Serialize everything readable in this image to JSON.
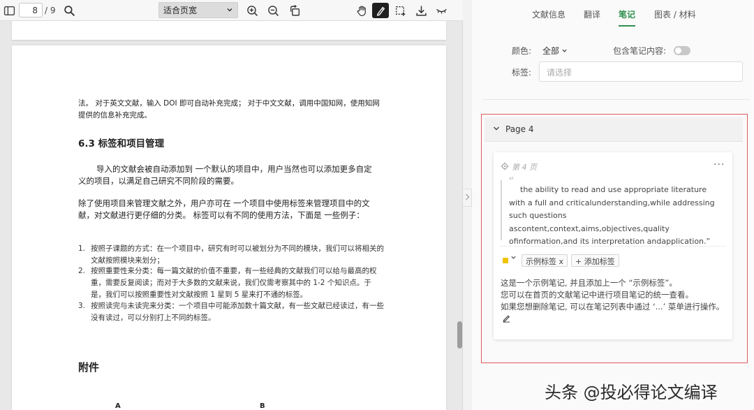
{
  "toolbar": {
    "current_page": "8",
    "total_pages": "/ 9",
    "zoom_select": "适合页宽",
    "icons": [
      "sidebar-toggle-icon",
      "search-icon",
      "zoom-in-icon",
      "zoom-out-icon",
      "rotate-icon",
      "hand-icon",
      "highlight-pen-icon",
      "select-area-icon",
      "download-icon",
      "eye-closed-icon"
    ]
  },
  "pdf": {
    "para1": "法。 对于英文文献，输入 DOI 即可自动补充完成； 对于中文文献，调用中国知网，使用知网提供的信息补充完成。",
    "heading": "6.3  标签和项目管理",
    "para2": "导入的文献会被自动添加到 一个默认的项目中，用户当然也可以添加更多自定义的项目，以满足自己研究不同阶段的需要。",
    "para3": "除了使用项目来管理文献之外，用户亦可在 一个项目中使用标签来管理项目中的文献，对文献进行更仔细的分类。 标签可以有不同的使用方法，下面是 一些例子：",
    "list": [
      {
        "num": "1.",
        "text": "按照子课题的方式：在一个项目中，研究有时可以被划分为不同的模块，我们可以将相关的文献按照模块来划分；"
      },
      {
        "num": "2.",
        "text": "按照重要性来分类：每一篇文献的价值不重要，有一些经典的文献我们可以给与最高的权重，需要反复阅读；而对于大多数的文献来说，我们仅需考察其中的 1-2 个知识点。于是，我们可以按照重要性对文献按照 1 星到 5 星来打不通的标签。"
      },
      {
        "num": "3.",
        "text": "按照读完与未读完来分类：一个项目中可能添加数十篇文献，有一些文献已经读过，有一些没有读过，可以分别打上不同的标签。"
      }
    ],
    "appendix": "附件",
    "bottom_a": "A",
    "bottom_b": "B"
  },
  "panel": {
    "tabs": [
      {
        "label": "文献信息"
      },
      {
        "label": "翻译"
      },
      {
        "label": "笔记"
      },
      {
        "label": "图表 / 材料"
      }
    ],
    "active_tab": "笔记",
    "color_label": "颜色:",
    "color_value": "全部",
    "include_label": "包含笔记内容:",
    "tag_label": "标签:",
    "tag_placeholder": "请选择",
    "group_title": "Page 4",
    "note": {
      "page_ref": "第 4 页",
      "quote": "the ability to read and use appropriate literature with a full and criticalunderstanding,while addressing such questions ascontent,context,aims,objectives,quality ofinformation,and its interpretation andapplication.”",
      "color": "#f2c400",
      "tag_chip": "示例标签 x",
      "add_tag": "+ 添加标签",
      "body_line1": "这是一个示例笔记, 并且添加上一个 “示例标签”。",
      "body_line2": "您可以在首页的文献笔记中进行项目笔记的统一查看。",
      "body_line3": "如果您想删除笔记, 可以在笔记列表中通过 ‘...’ 菜单进行操作。"
    }
  },
  "watermark": "头条 @投必得论文编译",
  "colors": {
    "accent": "#2f8f4e",
    "highlight_border": "#e15a5a"
  }
}
